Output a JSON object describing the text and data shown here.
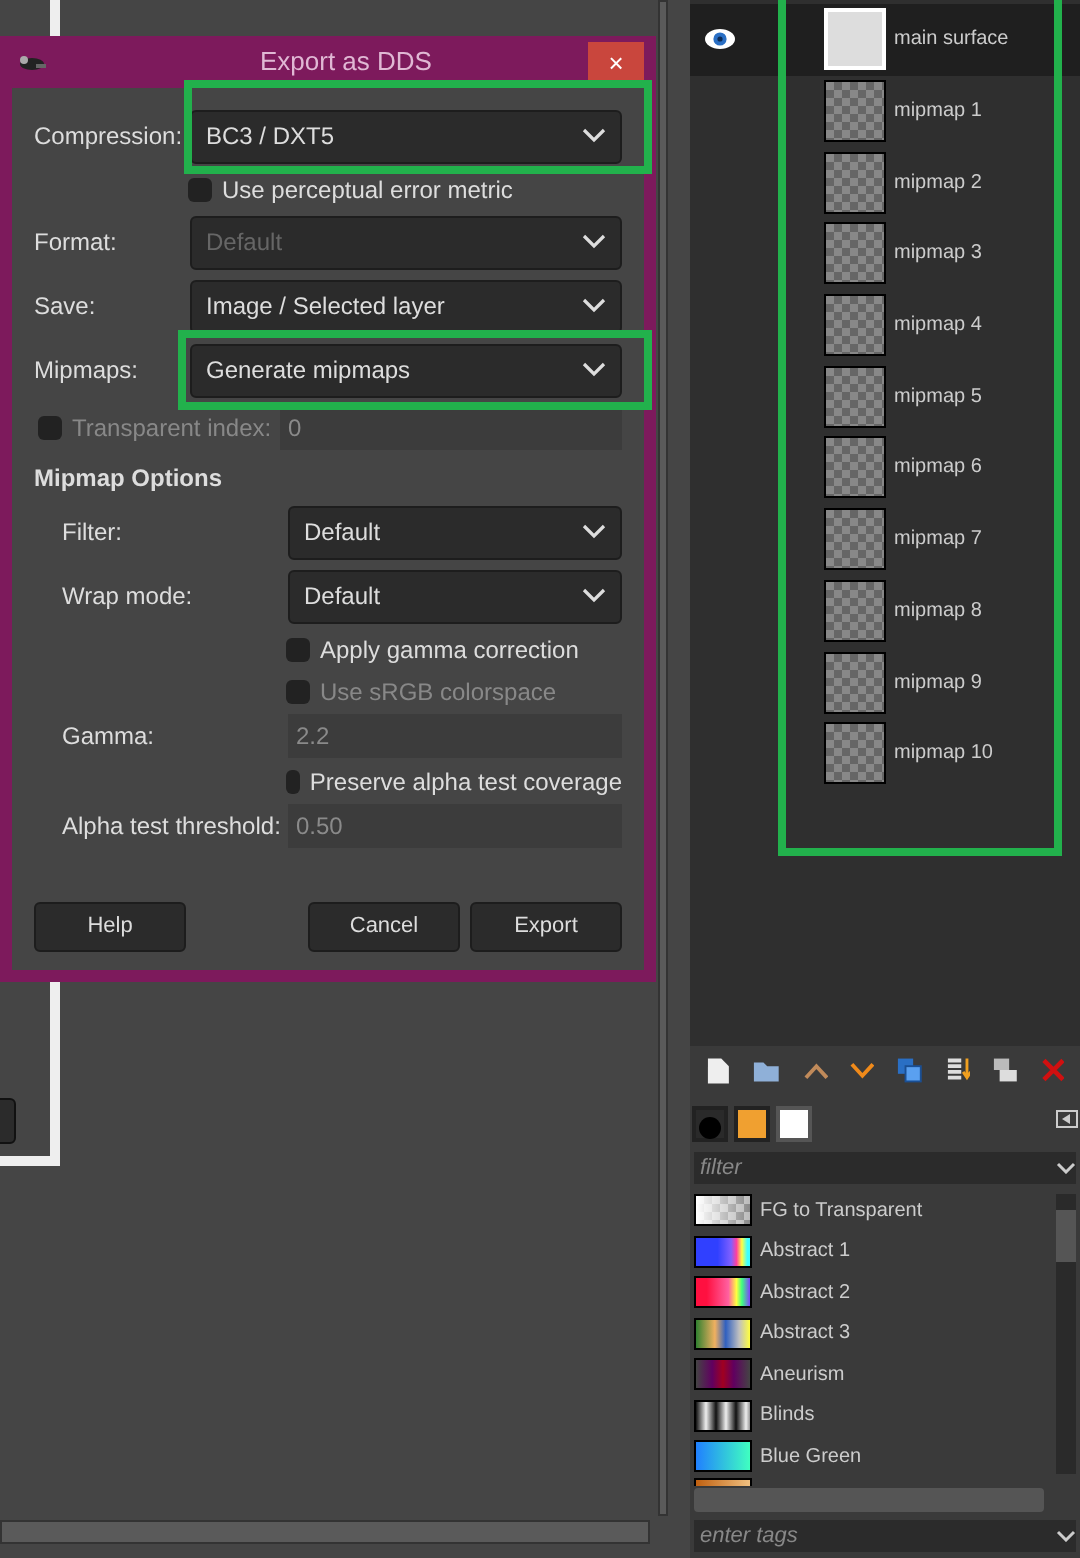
{
  "dialog": {
    "title": "Export as DDS",
    "close": "×",
    "fields": [
      {
        "kind": "select",
        "label": "Compression:",
        "value": "BC3 / DXT5",
        "disabled": false,
        "highlighted": true
      },
      {
        "kind": "checkbox",
        "label": "Use perceptual error metric",
        "checked": false,
        "disabled": false
      },
      {
        "kind": "select",
        "label": "Format:",
        "value": "Default",
        "disabled": true,
        "highlighted": false
      },
      {
        "kind": "select",
        "label": "Save:",
        "value": "Image / Selected layer",
        "disabled": false,
        "highlighted": false
      },
      {
        "kind": "select",
        "label": "Mipmaps:",
        "value": "Generate mipmaps",
        "disabled": false,
        "highlighted": true
      },
      {
        "kind": "checkspin",
        "label": "Transparent index:",
        "value": "0",
        "checked": false,
        "disabled": true
      },
      {
        "kind": "heading",
        "label": "Mipmap Options"
      },
      {
        "kind": "select",
        "label": "Filter:",
        "value": "Default",
        "disabled": false,
        "highlighted": false
      },
      {
        "kind": "select",
        "label": "Wrap mode:",
        "value": "Default",
        "disabled": false,
        "highlighted": false
      },
      {
        "kind": "checkbox",
        "label": "Apply gamma correction",
        "checked": false,
        "disabled": false
      },
      {
        "kind": "checkbox",
        "label": "Use sRGB colorspace",
        "checked": false,
        "disabled": true
      },
      {
        "kind": "spin",
        "label": "Gamma:",
        "value": "2.2",
        "disabled": true
      },
      {
        "kind": "checkbox",
        "label": "Preserve alpha test coverage",
        "checked": false,
        "disabled": false
      },
      {
        "kind": "spin",
        "label": "Alpha test threshold:",
        "value": "0.50",
        "disabled": true
      }
    ],
    "buttons": [
      "Help",
      "Cancel",
      "Export"
    ]
  },
  "layers": [
    {
      "name": "main surface",
      "visible": true,
      "selected": true
    },
    {
      "name": "mipmap 1",
      "visible": false,
      "selected": false
    },
    {
      "name": "mipmap 2",
      "visible": false,
      "selected": false
    },
    {
      "name": "mipmap 3",
      "visible": false,
      "selected": false
    },
    {
      "name": "mipmap 4",
      "visible": false,
      "selected": false
    },
    {
      "name": "mipmap 5",
      "visible": false,
      "selected": false
    },
    {
      "name": "mipmap 6",
      "visible": false,
      "selected": false
    },
    {
      "name": "mipmap 7",
      "visible": false,
      "selected": false
    },
    {
      "name": "mipmap 8",
      "visible": false,
      "selected": false
    },
    {
      "name": "mipmap 9",
      "visible": false,
      "selected": false
    },
    {
      "name": "mipmap 10",
      "visible": false,
      "selected": false
    }
  ],
  "gradients": {
    "filter_placeholder": "filter",
    "tags_placeholder": "enter tags",
    "items": [
      "FG to Transparent",
      "Abstract 1",
      "Abstract 2",
      "Abstract 3",
      "Aneurism",
      "Blinds",
      "Blue Green"
    ]
  }
}
